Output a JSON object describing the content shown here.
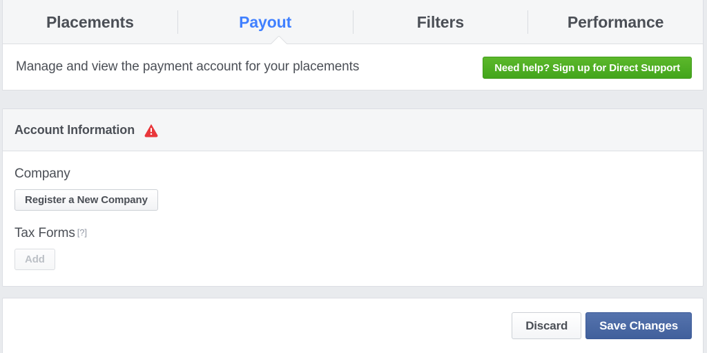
{
  "tabs": [
    {
      "label": "Placements",
      "active": false
    },
    {
      "label": "Payout",
      "active": true
    },
    {
      "label": "Filters",
      "active": false
    },
    {
      "label": "Performance",
      "active": false
    }
  ],
  "description": {
    "text": "Manage and view the payment account for your placements",
    "support_button": "Need help? Sign up for Direct Support"
  },
  "account_section": {
    "title": "Account Information",
    "warning_icon": "warning-triangle-icon",
    "fields": [
      {
        "label": "Company",
        "button": "Register a New Company",
        "disabled": false,
        "help": ""
      },
      {
        "label": "Tax Forms",
        "button": "Add",
        "disabled": true,
        "help": "[?]"
      }
    ]
  },
  "footer": {
    "discard_label": "Discard",
    "save_label": "Save Changes"
  },
  "colors": {
    "accent_blue": "#4080ff",
    "primary_button": "#4a67a5",
    "support_green": "#4cae23",
    "warning_red": "#e9373b",
    "page_background": "#e9ebee",
    "panel_header": "#f5f6f7",
    "text": "#4b4f56"
  }
}
